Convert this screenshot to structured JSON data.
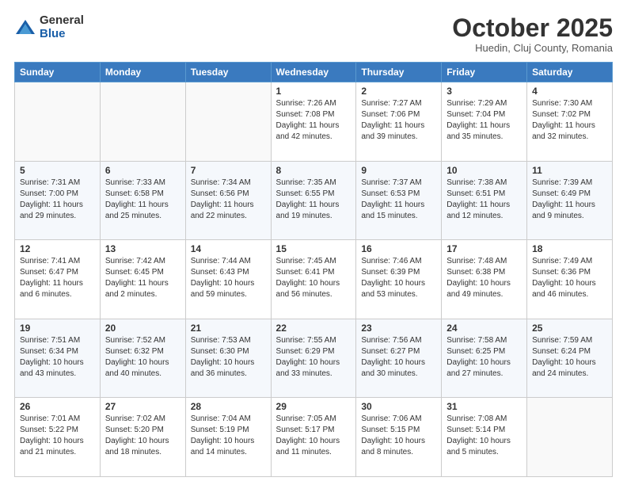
{
  "logo": {
    "general": "General",
    "blue": "Blue"
  },
  "header": {
    "month": "October 2025",
    "location": "Huedin, Cluj County, Romania"
  },
  "days_of_week": [
    "Sunday",
    "Monday",
    "Tuesday",
    "Wednesday",
    "Thursday",
    "Friday",
    "Saturday"
  ],
  "weeks": [
    [
      {
        "day": "",
        "info": ""
      },
      {
        "day": "",
        "info": ""
      },
      {
        "day": "",
        "info": ""
      },
      {
        "day": "1",
        "info": "Sunrise: 7:26 AM\nSunset: 7:08 PM\nDaylight: 11 hours\nand 42 minutes."
      },
      {
        "day": "2",
        "info": "Sunrise: 7:27 AM\nSunset: 7:06 PM\nDaylight: 11 hours\nand 39 minutes."
      },
      {
        "day": "3",
        "info": "Sunrise: 7:29 AM\nSunset: 7:04 PM\nDaylight: 11 hours\nand 35 minutes."
      },
      {
        "day": "4",
        "info": "Sunrise: 7:30 AM\nSunset: 7:02 PM\nDaylight: 11 hours\nand 32 minutes."
      }
    ],
    [
      {
        "day": "5",
        "info": "Sunrise: 7:31 AM\nSunset: 7:00 PM\nDaylight: 11 hours\nand 29 minutes."
      },
      {
        "day": "6",
        "info": "Sunrise: 7:33 AM\nSunset: 6:58 PM\nDaylight: 11 hours\nand 25 minutes."
      },
      {
        "day": "7",
        "info": "Sunrise: 7:34 AM\nSunset: 6:56 PM\nDaylight: 11 hours\nand 22 minutes."
      },
      {
        "day": "8",
        "info": "Sunrise: 7:35 AM\nSunset: 6:55 PM\nDaylight: 11 hours\nand 19 minutes."
      },
      {
        "day": "9",
        "info": "Sunrise: 7:37 AM\nSunset: 6:53 PM\nDaylight: 11 hours\nand 15 minutes."
      },
      {
        "day": "10",
        "info": "Sunrise: 7:38 AM\nSunset: 6:51 PM\nDaylight: 11 hours\nand 12 minutes."
      },
      {
        "day": "11",
        "info": "Sunrise: 7:39 AM\nSunset: 6:49 PM\nDaylight: 11 hours\nand 9 minutes."
      }
    ],
    [
      {
        "day": "12",
        "info": "Sunrise: 7:41 AM\nSunset: 6:47 PM\nDaylight: 11 hours\nand 6 minutes."
      },
      {
        "day": "13",
        "info": "Sunrise: 7:42 AM\nSunset: 6:45 PM\nDaylight: 11 hours\nand 2 minutes."
      },
      {
        "day": "14",
        "info": "Sunrise: 7:44 AM\nSunset: 6:43 PM\nDaylight: 10 hours\nand 59 minutes."
      },
      {
        "day": "15",
        "info": "Sunrise: 7:45 AM\nSunset: 6:41 PM\nDaylight: 10 hours\nand 56 minutes."
      },
      {
        "day": "16",
        "info": "Sunrise: 7:46 AM\nSunset: 6:39 PM\nDaylight: 10 hours\nand 53 minutes."
      },
      {
        "day": "17",
        "info": "Sunrise: 7:48 AM\nSunset: 6:38 PM\nDaylight: 10 hours\nand 49 minutes."
      },
      {
        "day": "18",
        "info": "Sunrise: 7:49 AM\nSunset: 6:36 PM\nDaylight: 10 hours\nand 46 minutes."
      }
    ],
    [
      {
        "day": "19",
        "info": "Sunrise: 7:51 AM\nSunset: 6:34 PM\nDaylight: 10 hours\nand 43 minutes."
      },
      {
        "day": "20",
        "info": "Sunrise: 7:52 AM\nSunset: 6:32 PM\nDaylight: 10 hours\nand 40 minutes."
      },
      {
        "day": "21",
        "info": "Sunrise: 7:53 AM\nSunset: 6:30 PM\nDaylight: 10 hours\nand 36 minutes."
      },
      {
        "day": "22",
        "info": "Sunrise: 7:55 AM\nSunset: 6:29 PM\nDaylight: 10 hours\nand 33 minutes."
      },
      {
        "day": "23",
        "info": "Sunrise: 7:56 AM\nSunset: 6:27 PM\nDaylight: 10 hours\nand 30 minutes."
      },
      {
        "day": "24",
        "info": "Sunrise: 7:58 AM\nSunset: 6:25 PM\nDaylight: 10 hours\nand 27 minutes."
      },
      {
        "day": "25",
        "info": "Sunrise: 7:59 AM\nSunset: 6:24 PM\nDaylight: 10 hours\nand 24 minutes."
      }
    ],
    [
      {
        "day": "26",
        "info": "Sunrise: 7:01 AM\nSunset: 5:22 PM\nDaylight: 10 hours\nand 21 minutes."
      },
      {
        "day": "27",
        "info": "Sunrise: 7:02 AM\nSunset: 5:20 PM\nDaylight: 10 hours\nand 18 minutes."
      },
      {
        "day": "28",
        "info": "Sunrise: 7:04 AM\nSunset: 5:19 PM\nDaylight: 10 hours\nand 14 minutes."
      },
      {
        "day": "29",
        "info": "Sunrise: 7:05 AM\nSunset: 5:17 PM\nDaylight: 10 hours\nand 11 minutes."
      },
      {
        "day": "30",
        "info": "Sunrise: 7:06 AM\nSunset: 5:15 PM\nDaylight: 10 hours\nand 8 minutes."
      },
      {
        "day": "31",
        "info": "Sunrise: 7:08 AM\nSunset: 5:14 PM\nDaylight: 10 hours\nand 5 minutes."
      },
      {
        "day": "",
        "info": ""
      }
    ]
  ]
}
